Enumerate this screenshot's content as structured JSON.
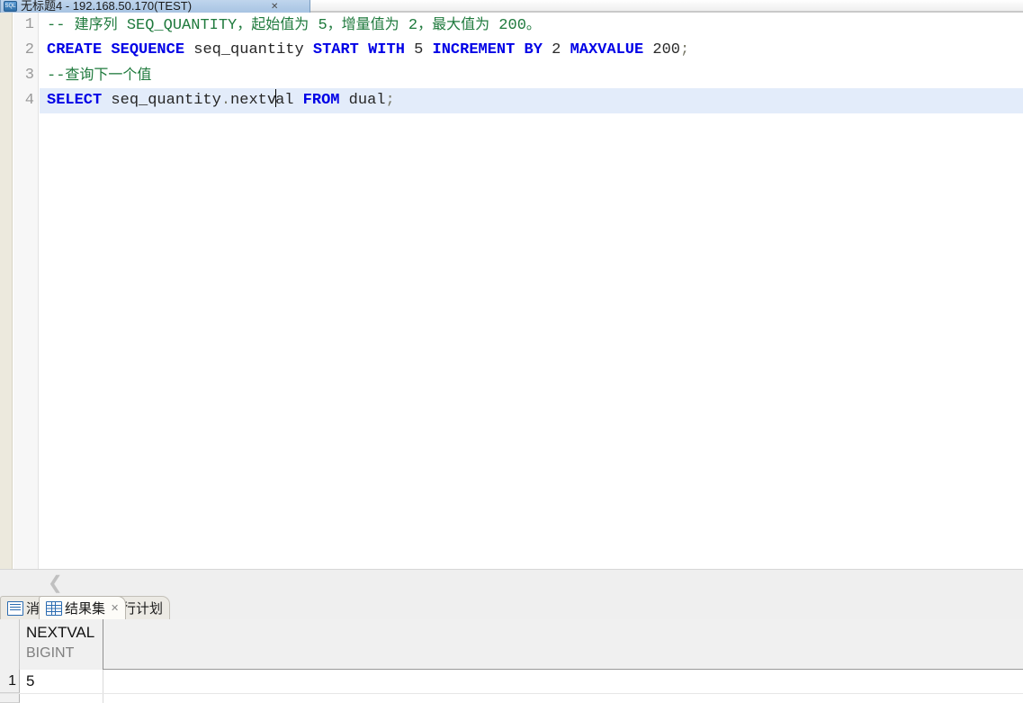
{
  "editor_tab": {
    "icon": "sql-file-icon",
    "title": "无标题4 - 192.168.50.170(TEST)",
    "close": "✕"
  },
  "editor": {
    "lines": [
      {
        "number": "1",
        "tokens": [
          {
            "kind": "comment",
            "text": "-- "
          },
          {
            "kind": "comment-cn",
            "text": "建序列"
          },
          {
            "kind": "comment",
            "text": " SEQ_QUANTITY"
          },
          {
            "kind": "comment-cn",
            "text": "，起始值为"
          },
          {
            "kind": "comment",
            "text": " 5"
          },
          {
            "kind": "comment-cn",
            "text": "，增量值为"
          },
          {
            "kind": "comment",
            "text": " 2"
          },
          {
            "kind": "comment-cn",
            "text": "，最大值为"
          },
          {
            "kind": "comment",
            "text": " 200"
          },
          {
            "kind": "comment-cn",
            "text": "。"
          }
        ]
      },
      {
        "number": "2",
        "tokens": [
          {
            "kind": "kw",
            "text": "CREATE"
          },
          {
            "kind": "plain",
            "text": " "
          },
          {
            "kind": "kw",
            "text": "SEQUENCE"
          },
          {
            "kind": "plain",
            "text": " seq_quantity "
          },
          {
            "kind": "kw",
            "text": "START"
          },
          {
            "kind": "plain",
            "text": " "
          },
          {
            "kind": "kw",
            "text": "WITH"
          },
          {
            "kind": "plain",
            "text": " "
          },
          {
            "kind": "num",
            "text": "5"
          },
          {
            "kind": "plain",
            "text": " "
          },
          {
            "kind": "kw",
            "text": "INCREMENT"
          },
          {
            "kind": "plain",
            "text": " "
          },
          {
            "kind": "kw",
            "text": "BY"
          },
          {
            "kind": "plain",
            "text": " "
          },
          {
            "kind": "num",
            "text": "2"
          },
          {
            "kind": "plain",
            "text": " "
          },
          {
            "kind": "kw",
            "text": "MAXVALUE"
          },
          {
            "kind": "plain",
            "text": " "
          },
          {
            "kind": "num",
            "text": "200"
          },
          {
            "kind": "punc",
            "text": ";"
          }
        ]
      },
      {
        "number": "3",
        "tokens": [
          {
            "kind": "comment",
            "text": "--"
          },
          {
            "kind": "comment-cn",
            "text": "查询下一个值"
          }
        ]
      },
      {
        "number": "4",
        "tokens": [
          {
            "kind": "kw",
            "text": "SELECT"
          },
          {
            "kind": "plain",
            "text": " seq_quantity"
          },
          {
            "kind": "punc",
            "text": "."
          },
          {
            "kind": "plain",
            "text": "nextv"
          },
          {
            "kind": "caret",
            "text": ""
          },
          {
            "kind": "plain",
            "text": "al "
          },
          {
            "kind": "kw",
            "text": "FROM"
          },
          {
            "kind": "plain",
            "text": " dual"
          },
          {
            "kind": "punc",
            "text": ";"
          }
        ],
        "selection_highlight": true
      }
    ]
  },
  "splitter": {
    "collapse_chevron": "❮"
  },
  "result_tabs": [
    {
      "label": "消息",
      "icon": "messages-icon",
      "active": false,
      "closeable": false
    },
    {
      "label": "结果集",
      "icon": "result-grid-icon",
      "active": true,
      "closeable": true,
      "close": "✕"
    },
    {
      "label": "执行计划",
      "icon": "execution-plan-icon",
      "active": false,
      "closeable": false
    }
  ],
  "result_grid": {
    "columns": [
      {
        "name": "NEXTVAL",
        "type": "BIGINT"
      }
    ],
    "rows": [
      {
        "num": "1",
        "values": [
          "5"
        ]
      }
    ]
  }
}
